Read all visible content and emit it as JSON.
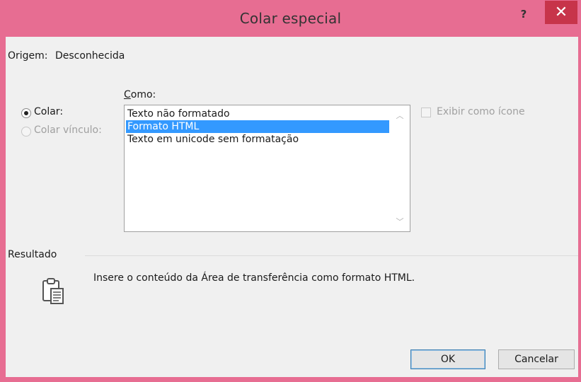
{
  "window": {
    "title": "Colar especial",
    "help_label": "?",
    "close_label": "✕"
  },
  "source": {
    "label": "Origem:",
    "value": "Desconhecida"
  },
  "como_label": "Como:",
  "options": {
    "paste_label": "Colar:",
    "paste_link_label": "Colar vínculo:",
    "paste_selected": true,
    "paste_link_enabled": false
  },
  "formats": {
    "items": [
      {
        "label": "Texto não formatado",
        "selected": false
      },
      {
        "label": "Formato HTML",
        "selected": true
      },
      {
        "label": "Texto em unicode sem formatação",
        "selected": false
      }
    ]
  },
  "display_as_icon": {
    "label": "Exibir como ícone",
    "checked": false,
    "enabled": false
  },
  "result": {
    "heading": "Resultado",
    "description": "Insere o conteúdo da Área de transferência como formato HTML."
  },
  "buttons": {
    "ok_label": "OK",
    "cancel_label": "Cancelar"
  },
  "icons": [
    "help-icon",
    "close-icon",
    "clipboard-icon",
    "scroll-up-icon",
    "scroll-down-icon"
  ],
  "colors": {
    "title_bar": "#e76d92",
    "close_button": "#c7344a",
    "selection": "#3399ff",
    "dialog_background": "#f0f0f0"
  }
}
